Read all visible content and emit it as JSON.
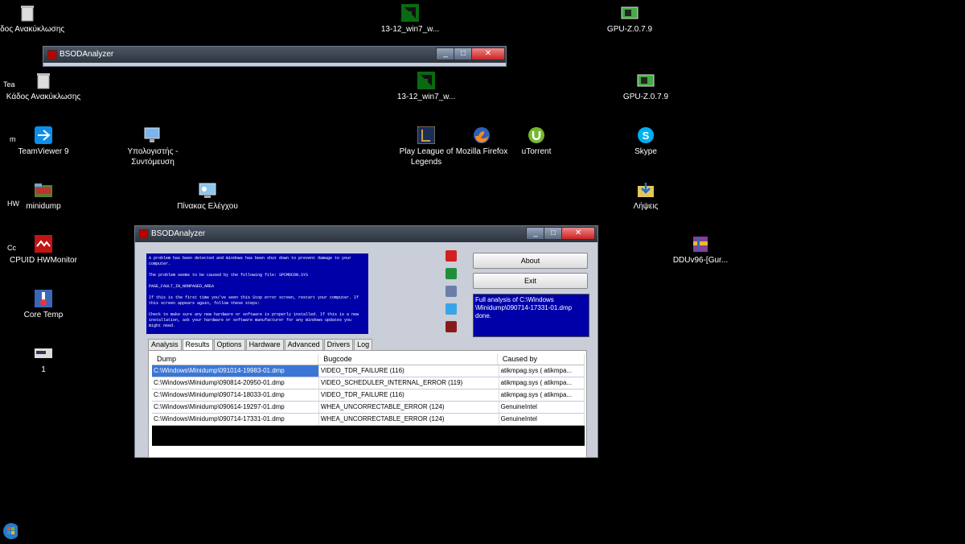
{
  "desktop_top": [
    {
      "label": "Κάδος Ανακύκλωσης",
      "icon": "recycle-bin-icon"
    },
    {
      "label": "13-12_win7_w...",
      "icon": "amd-icon"
    },
    {
      "label": "GPU-Z.0.7.9",
      "icon": "gpuz-icon"
    }
  ],
  "desktop": [
    {
      "label": "Κάδος Ανακύκλωσης",
      "icon": "recycle-bin-icon"
    },
    {
      "label": "13-12_win7_w...",
      "icon": "amd-icon"
    },
    {
      "label": "GPU-Z.0.7.9",
      "icon": "gpuz-icon"
    },
    {
      "label": "TeamViewer 9",
      "icon": "teamviewer-icon"
    },
    {
      "label": "Υπολογιστής - Συντόμευση",
      "icon": "computer-icon"
    },
    {
      "label": "Play League of Legends",
      "icon": "lol-icon"
    },
    {
      "label": "Mozilla Firefox",
      "icon": "firefox-icon"
    },
    {
      "label": "uTorrent",
      "icon": "utorrent-icon"
    },
    {
      "label": "Skype",
      "icon": "skype-icon"
    },
    {
      "label": "minidump",
      "icon": "folder-icon"
    },
    {
      "label": "Πίνακας Ελέγχου",
      "icon": "control-panel-icon"
    },
    {
      "label": "Λήψεις",
      "icon": "downloads-icon"
    },
    {
      "label": "CPUID HWMonitor",
      "icon": "hwmonitor-icon"
    },
    {
      "label": "DDUv96-[Gur...",
      "icon": "winrar-icon"
    },
    {
      "label": "Core Temp",
      "icon": "coretemp-icon"
    },
    {
      "label": "1",
      "icon": "file-icon"
    }
  ],
  "partial_left": [
    "Tea",
    "m",
    "HW",
    "Cc"
  ],
  "bg_window": {
    "title": "BSODAnalyzer"
  },
  "main_window": {
    "title": "BSODAnalyzer",
    "bsod_text": "A problem has been detected and Windows has been shut down to prevent damage to your computer.\n\nThe problem seems to be caused by the following file: SPCMDCON.SYS\n\nPAGE_FAULT_IN_NONPAGED_AREA\n\nIf this is the first time you've seen this Stop error screen, restart your computer. If this screen appears again, follow these steps:\n\nCheck to make sure any new hardware or software is properly installed. If this is a new installation, ask your hardware or software manufacturer for any Windows updates you might need.",
    "about": "About",
    "exit": "Exit",
    "status": "Full analysis of C:\\Windows \\Minidump\\090714-17331-01.dmp done.",
    "tabs": [
      "Analysis",
      "Results",
      "Options",
      "Hardware",
      "Advanced",
      "Drivers",
      "Log"
    ],
    "active_tab": "Results",
    "columns": [
      "Dump",
      "Bugcode",
      "Caused by"
    ],
    "rows": [
      {
        "dump": "C:\\Windows\\Minidump\\091014-19983-01.dmp",
        "bugcode": "VIDEO_TDR_FAILURE (116)",
        "cause": "atikmpag.sys ( atikmpa..."
      },
      {
        "dump": "C:\\Windows\\Minidump\\090814-20950-01.dmp",
        "bugcode": "VIDEO_SCHEDULER_INTERNAL_ERROR (119)",
        "cause": "atikmpag.sys ( atikmpa..."
      },
      {
        "dump": "C:\\Windows\\Minidump\\090714-18033-01.dmp",
        "bugcode": "VIDEO_TDR_FAILURE (116)",
        "cause": "atikmpag.sys ( atikmpa..."
      },
      {
        "dump": "C:\\Windows\\Minidump\\090614-19297-01.dmp",
        "bugcode": "WHEA_UNCORRECTABLE_ERROR (124)",
        "cause": "GenuineIntel"
      },
      {
        "dump": "C:\\Windows\\Minidump\\090714-17331-01.dmp",
        "bugcode": "WHEA_UNCORRECTABLE_ERROR (124)",
        "cause": "GenuineIntel"
      }
    ]
  }
}
